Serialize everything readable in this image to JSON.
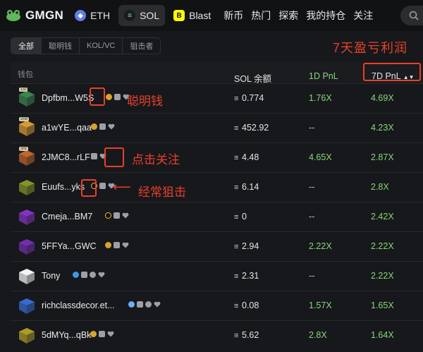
{
  "nav": {
    "brand": "GMGN",
    "chains": [
      {
        "label": "ETH",
        "active": false,
        "icon": "eth-icon",
        "color": "#627eea"
      },
      {
        "label": "SOL",
        "active": true,
        "icon": "sol-icon",
        "color": "#9945ff"
      },
      {
        "label": "Blast",
        "active": false,
        "icon": "blast-icon",
        "color": "#fcfc03"
      }
    ],
    "menu": [
      "新币",
      "热门",
      "探索",
      "我的持仓",
      "关注"
    ]
  },
  "filters": [
    {
      "label": "全部",
      "active": true
    },
    {
      "label": "聪明钱",
      "active": false
    },
    {
      "label": "KOL/VC",
      "active": false
    },
    {
      "label": "狙击者",
      "active": false
    }
  ],
  "table": {
    "headers": {
      "wallet": "钱包",
      "sol": "SOL 余额",
      "pnl_1d": "1D PnL",
      "pnl_7d": "7D PnL"
    },
    "rows": [
      {
        "name": "Dpfbm...W5S",
        "sol": "0.774",
        "pnl_1d": "1.76X",
        "pnl_7d": "4.69X",
        "rank": "1st",
        "avatar_color": "#3d8b55",
        "badges": [
          "money-bag-icon",
          "copy-icon",
          "heart-icon"
        ]
      },
      {
        "name": "a1wYE...qaa",
        "sol": "452.92",
        "pnl_1d": "--",
        "pnl_7d": "4.23X",
        "rank": "2nd",
        "avatar_color": "#e0a23a",
        "badges": [
          "money-bag-icon",
          "copy-icon",
          "heart-icon"
        ]
      },
      {
        "name": "2JMC8...rLF",
        "sol": "4.48",
        "pnl_1d": "4.65X",
        "pnl_7d": "2.87X",
        "rank": "3rd",
        "avatar_color": "#c96a2e",
        "badges": [
          "copy-icon",
          "heart-icon"
        ]
      },
      {
        "name": "Euufs...yks",
        "sol": "6.14",
        "pnl_1d": "--",
        "pnl_7d": "2.8X",
        "rank": "",
        "avatar_color": "#8a9a2a",
        "badges": [
          "sniper-icon",
          "copy-icon",
          "heart-icon"
        ]
      },
      {
        "name": "Cmeja...BM7",
        "sol": "0",
        "pnl_1d": "--",
        "pnl_7d": "2.42X",
        "rank": "",
        "avatar_color": "#8a35c9",
        "badges": [
          "sniper-icon",
          "copy-icon",
          "heart-icon"
        ]
      },
      {
        "name": "5FFYa...GWC",
        "sol": "2.94",
        "pnl_1d": "2.22X",
        "pnl_7d": "2.22X",
        "rank": "",
        "avatar_color": "#7a2fb8",
        "badges": [
          "money-bag-icon",
          "copy-icon",
          "heart-icon"
        ]
      },
      {
        "name": "Tony",
        "sol": "2.31",
        "pnl_1d": "--",
        "pnl_7d": "2.22X",
        "rank": "",
        "avatar_color": "#f2f2f2",
        "badges": [
          "verified-icon",
          "copy-icon",
          "x-icon",
          "heart-icon"
        ]
      },
      {
        "name": "richclassdecor.et...",
        "sol": "0.08",
        "pnl_1d": "1.57X",
        "pnl_7d": "1.65X",
        "rank": "",
        "avatar_color": "#3c6fd8",
        "badges": [
          "snowflake-icon",
          "copy-icon",
          "x-icon",
          "heart-icon"
        ]
      },
      {
        "name": "5dMYq...qBk",
        "sol": "5.62",
        "pnl_1d": "2.8X",
        "pnl_7d": "1.64X",
        "rank": "",
        "avatar_color": "#b4a42a",
        "badges": [
          "money-bag-icon",
          "copy-icon",
          "heart-icon"
        ]
      }
    ]
  },
  "annotations": {
    "pnl_7d": "7天盈亏利润",
    "smart_money": "聪明钱",
    "follow": "点击关注",
    "sniper": "经常狙击",
    "arrow": "⟵"
  },
  "accent_color": "#e8402c",
  "positive_color": "#86d67a"
}
